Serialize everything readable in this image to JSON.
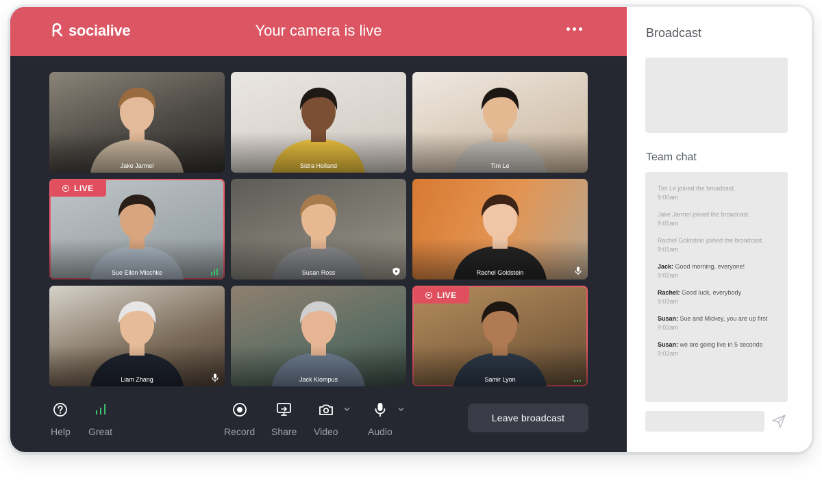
{
  "header": {
    "logo_text": "socialive",
    "title": "Your camera is live"
  },
  "participants": [
    {
      "name": "Jake Jarmel",
      "live": false,
      "indicator": "none"
    },
    {
      "name": "Sidra Holland",
      "live": false,
      "indicator": "none"
    },
    {
      "name": "Tim Le",
      "live": false,
      "indicator": "none"
    },
    {
      "name": "Sue Ellen Mischke",
      "live": true,
      "indicator": "signal"
    },
    {
      "name": "Susan Ross",
      "live": false,
      "indicator": "shield"
    },
    {
      "name": "Rachel Goldstein",
      "live": false,
      "indicator": "mic"
    },
    {
      "name": "Liam Zhang",
      "live": false,
      "indicator": "mic"
    },
    {
      "name": "Jack Klompus",
      "live": false,
      "indicator": "none"
    },
    {
      "name": "Samir Lyon",
      "live": true,
      "indicator": "dots"
    }
  ],
  "live_label": "LIVE",
  "controls": {
    "help": "Help",
    "connection": "Great",
    "record": "Record",
    "share": "Share",
    "video": "Video",
    "audio": "Audio",
    "leave": "Leave broadcast"
  },
  "sidebar": {
    "broadcast_title": "Broadcast",
    "chat_title": "Team chat",
    "messages": [
      {
        "sender": "",
        "text": "Tim Le joined the broadcast.",
        "time": "9:00am",
        "system": true
      },
      {
        "sender": "",
        "text": "Jake Jarmel joined the broadcast.",
        "time": "9:01am",
        "system": true
      },
      {
        "sender": "",
        "text": "Rachel Goldstein joined the broadcast.",
        "time": "9:01am",
        "system": true
      },
      {
        "sender": "Jack:",
        "text": " Good morning, everyone!",
        "time": "9:02am",
        "system": false
      },
      {
        "sender": "Rachel:",
        "text": " Good luck, everybody",
        "time": "9:03am",
        "system": false
      },
      {
        "sender": "Susan:",
        "text": " Sue and Mickey, you are up first",
        "time": "9:03am",
        "system": false
      },
      {
        "sender": "Susan:",
        "text": " we are going live in 5 seconds",
        "time": "9:03am",
        "system": false
      }
    ]
  },
  "colors": {
    "accent": "#dc5563",
    "panel": "#252731",
    "live_border": "#e85a68",
    "signal_green": "#3dbf6b"
  }
}
